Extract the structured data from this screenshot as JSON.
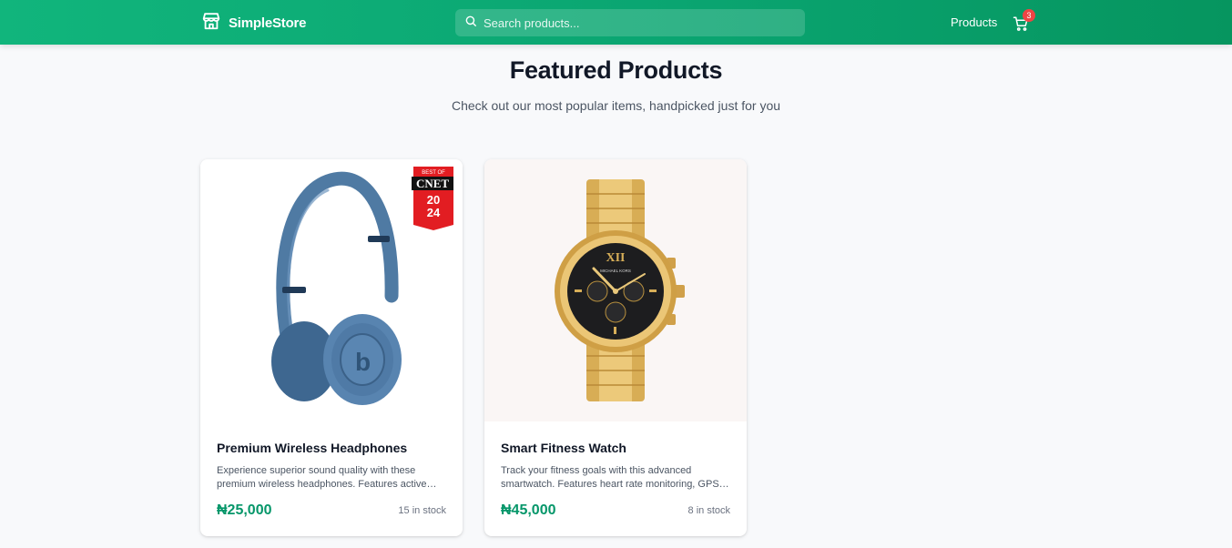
{
  "header": {
    "brand_name": "SimpleStore",
    "brand_icon": "store-icon",
    "search_placeholder": "Search products...",
    "nav_products": "Products",
    "cart_count": "3",
    "colors": {
      "primary": "#10b981",
      "badge": "#ef4444"
    }
  },
  "main": {
    "title": "Featured Products",
    "subtitle": "Check out our most popular items, handpicked just for you"
  },
  "products": [
    {
      "name": "Premium Wireless Headphones",
      "description": "Experience superior sound quality with these premium wireless headphones. Features active…",
      "price": "₦25,000",
      "stock": "15 in stock",
      "badge_top": "BEST OF",
      "badge_brand": "CNET",
      "badge_year_1": "20",
      "badge_year_2": "24"
    },
    {
      "name": "Smart Fitness Watch",
      "description": "Track your fitness goals with this advanced smartwatch. Features heart rate monitoring, GPS…",
      "price": "₦45,000",
      "stock": "8 in stock",
      "dial_brand": "MICHAEL KORS"
    }
  ]
}
